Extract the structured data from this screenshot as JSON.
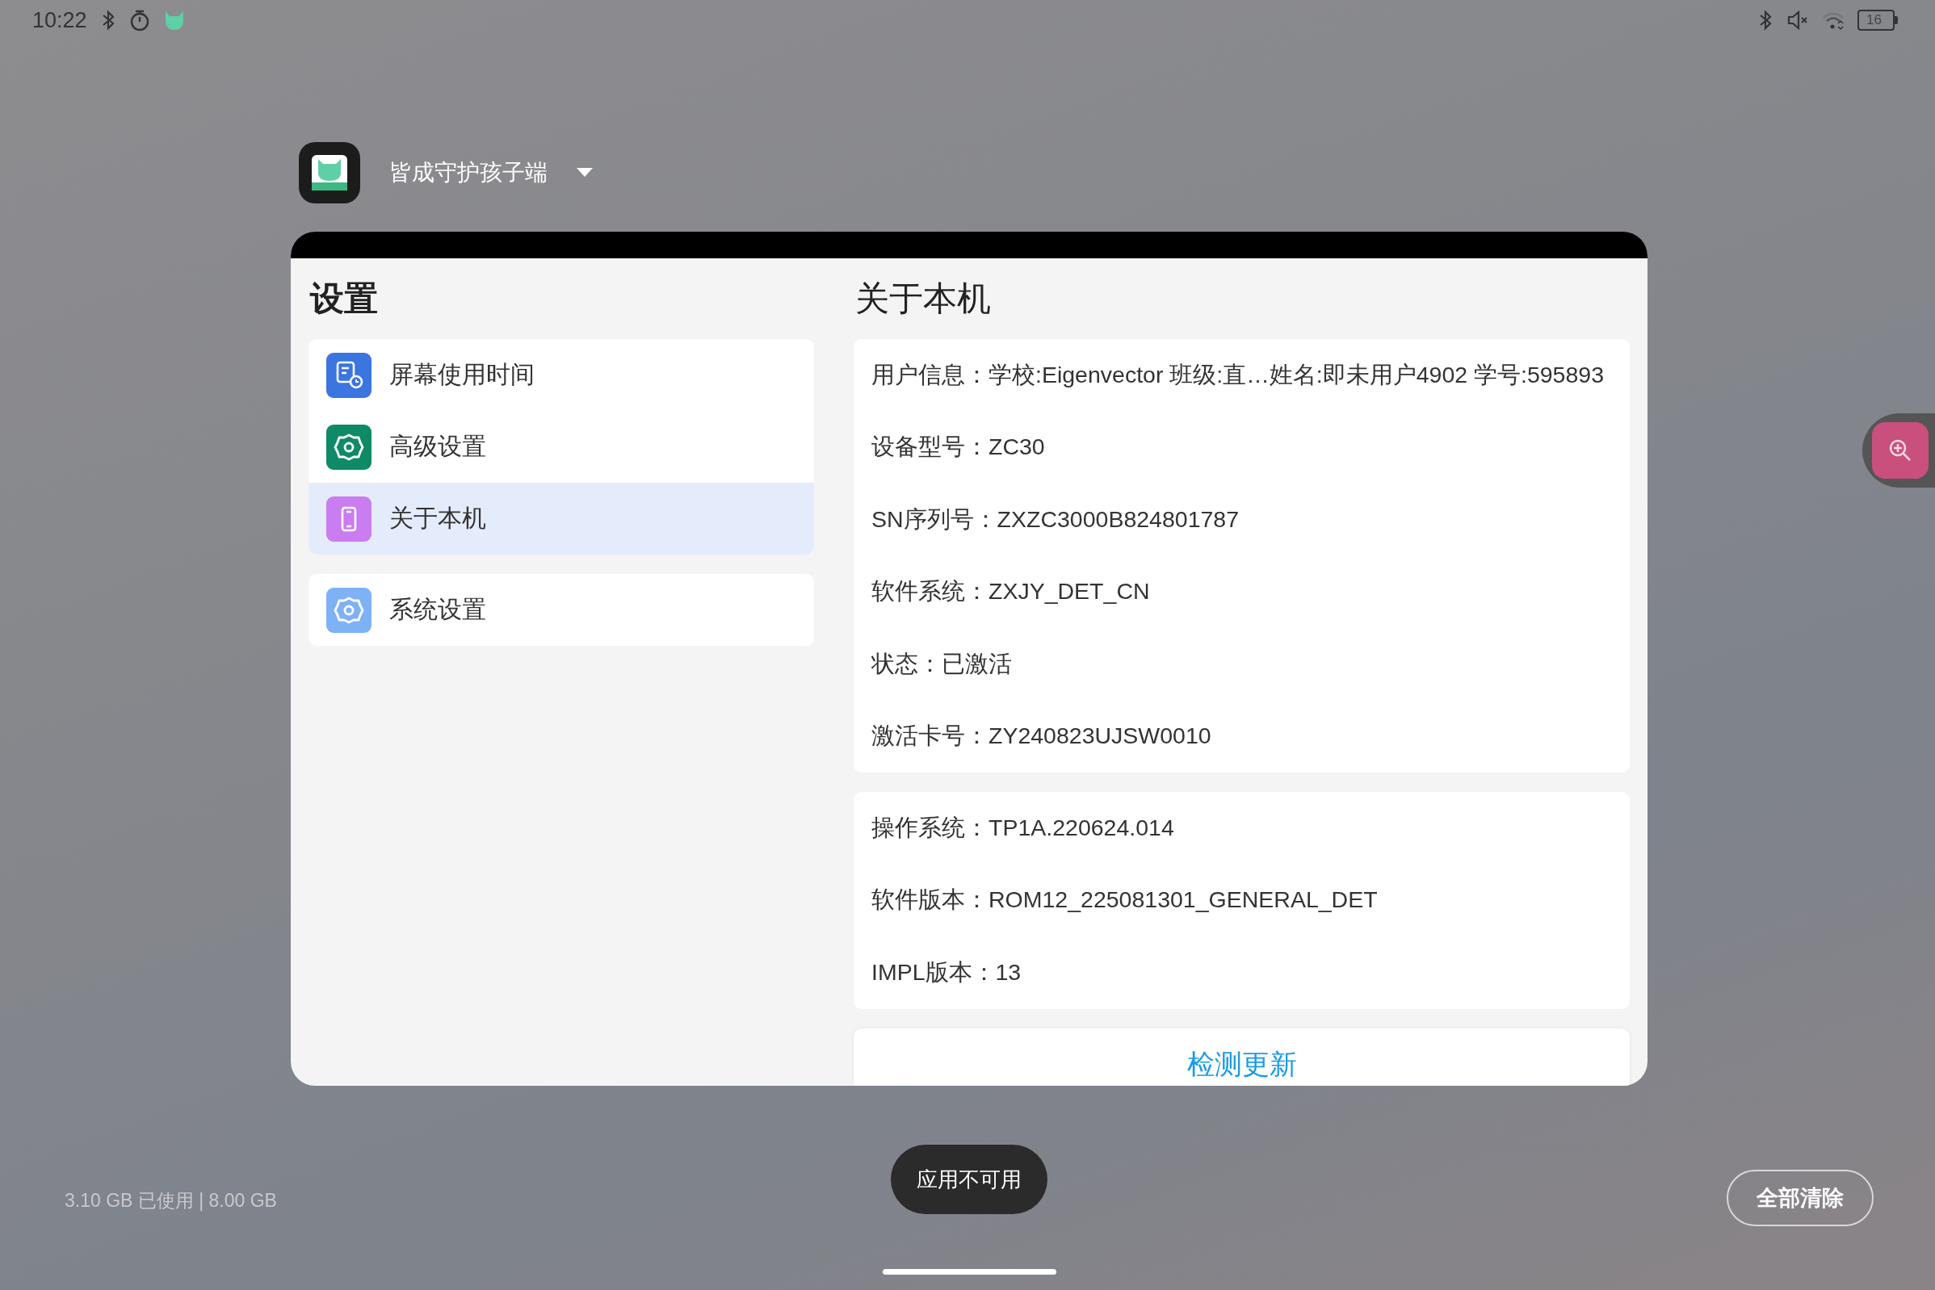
{
  "status_bar": {
    "time": "10:22",
    "battery": "16"
  },
  "app_switcher": {
    "app_name": "皆成守护孩子端"
  },
  "settings": {
    "title": "设置",
    "groups": [
      {
        "items": [
          {
            "label": "屏幕使用时间",
            "kind": "screen_time",
            "selected": false
          },
          {
            "label": "高级设置",
            "kind": "advanced",
            "selected": false
          },
          {
            "label": "关于本机",
            "kind": "about",
            "selected": true
          }
        ]
      },
      {
        "items": [
          {
            "label": "系统设置",
            "kind": "system",
            "selected": false
          }
        ]
      }
    ]
  },
  "about": {
    "title": "关于本机",
    "groups": [
      {
        "rows": [
          "用户信息：学校:Eigenvector 班级:直…姓名:即未用户4902 学号:595893",
          "设备型号：ZC30",
          "SN序列号：ZXZC3000B824801787",
          "软件系统：ZXJY_DET_CN",
          "状态：已激活",
          "激活卡号：ZY240823UJSW0010"
        ]
      },
      {
        "rows": [
          "操作系统：TP1A.220624.014",
          "软件版本：ROM12_225081301_GENERAL_DET",
          "IMPL版本：13"
        ]
      }
    ],
    "button": "检测更新"
  },
  "footer": {
    "memory": "3.10 GB 已使用 | 8.00 GB",
    "toast": "应用不可用",
    "clear_button": "全部清除"
  }
}
